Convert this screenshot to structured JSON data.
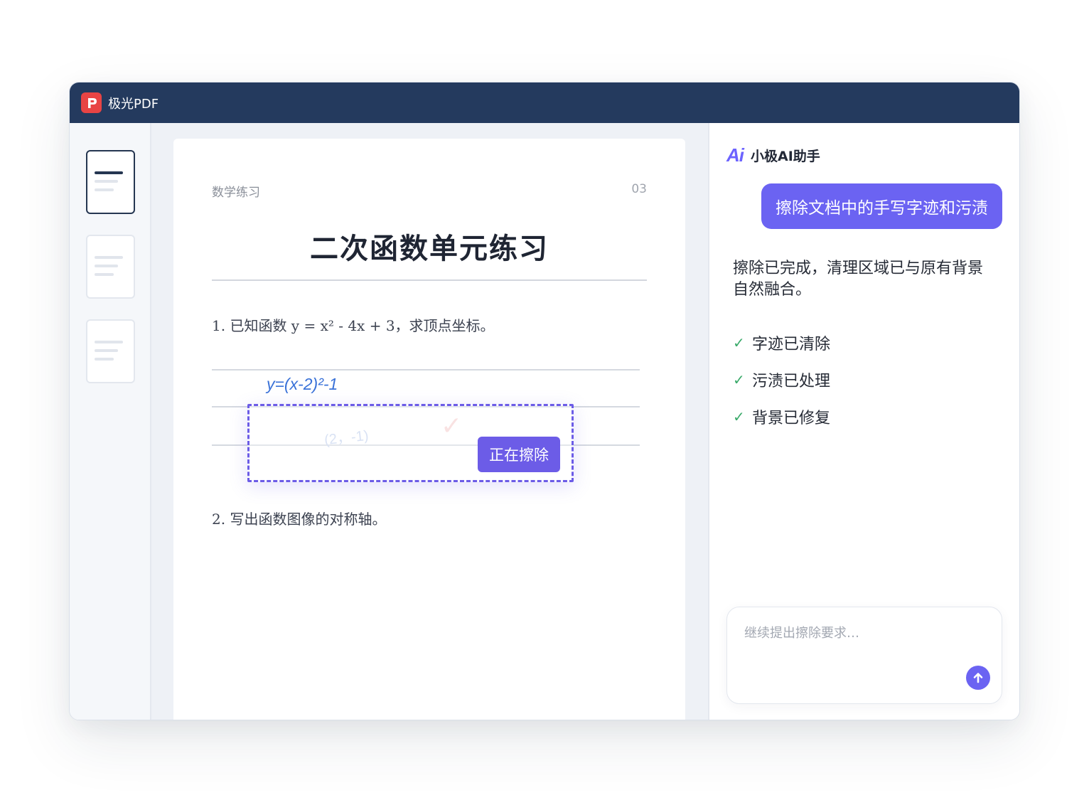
{
  "app": {
    "title": "极光PDF",
    "logo_icon": "app-logo-icon",
    "accent_color": "#6c5ce7",
    "titlebar_color": "#243a5e"
  },
  "sidebar": {
    "thumbnails": [
      {
        "active": true
      },
      {
        "active": false
      },
      {
        "active": false
      }
    ]
  },
  "document": {
    "category": "数学练习",
    "page_number": "03",
    "title": "二次函数单元练习",
    "questions": [
      {
        "text": "1. 已知函数 y = x² - 4x + 3，求顶点坐标。"
      },
      {
        "text": "2. 写出函数图像的对称轴。"
      }
    ],
    "handwriting": {
      "formula": "y=(x-2)²-1",
      "faded_answer": "(2，-1)",
      "faded_mark": "✓"
    },
    "erase_overlay": {
      "status_label": "正在擦除"
    }
  },
  "assistant": {
    "logo_text": "Ai",
    "name": "小极AI助手",
    "user_message": "擦除文档中的手写字迹和污渍",
    "reply": "擦除已完成，清理区域已与原有背景自然融合。",
    "checklist": [
      {
        "icon": "✓",
        "label": "字迹已清除"
      },
      {
        "icon": "✓",
        "label": "污渍已处理"
      },
      {
        "icon": "✓",
        "label": "背景已修复"
      }
    ],
    "input": {
      "placeholder": "继续提出擦除要求…"
    },
    "send_icon": "arrow-up-icon"
  }
}
